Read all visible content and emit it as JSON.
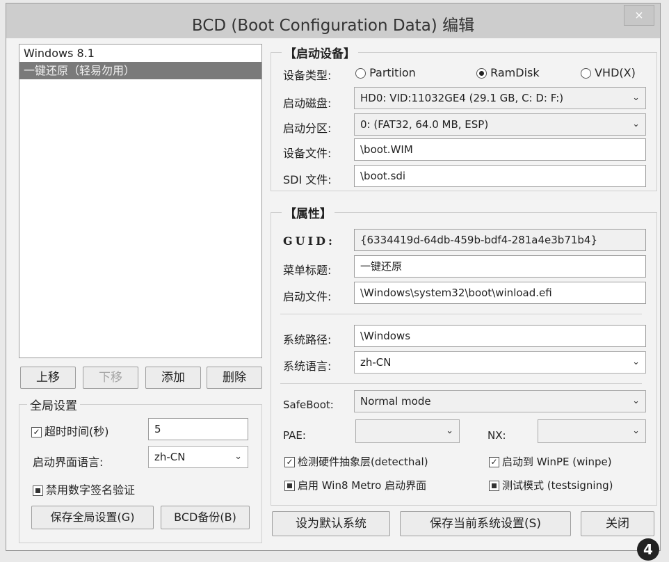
{
  "window": {
    "title": "BCD (Boot Configuration Data) 编辑",
    "close_glyph": "×"
  },
  "entries": [
    {
      "label": "Windows 8.1",
      "selected": false
    },
    {
      "label": "一键还原（轻易勿用）",
      "selected": true
    }
  ],
  "list_buttons": {
    "up": "上移",
    "down": "下移",
    "add": "添加",
    "delete": "删除"
  },
  "global": {
    "title": "全局设置",
    "timeout_label": "超时时间(秒)",
    "timeout_value": "5",
    "timeout_checked": true,
    "lang_label": "启动界面语言:",
    "lang_value": "zh-CN",
    "nosig_label": "禁用数字签名验证",
    "save_btn": "保存全局设置(G)",
    "backup_btn": "BCD备份(B)"
  },
  "boot_device": {
    "title": "【启动设备】",
    "type_label": "设备类型:",
    "type_options": [
      "Partition",
      "RamDisk",
      "VHD(X)"
    ],
    "type_selected": "RamDisk",
    "disk_label": "启动磁盘:",
    "disk_value": "HD0: VID:11032GE4 (29.1 GB, C: D: F:)",
    "partition_label": "启动分区:",
    "partition_value": "0: (FAT32,  64.0 MB, ESP)",
    "file_label": "设备文件:",
    "file_value": "\\boot.WIM",
    "sdi_label": "SDI 文件:",
    "sdi_value": "\\boot.sdi"
  },
  "properties": {
    "title": "【属性】",
    "guid_label": "GUID:",
    "guid_value": "{6334419d-64db-459b-bdf4-281a4e3b71b4}",
    "menu_label": "菜单标题:",
    "menu_value": "一键还原",
    "bootfile_label": "启动文件:",
    "bootfile_value": "\\Windows\\system32\\boot\\winload.efi",
    "syspath_label": "系统路径:",
    "syspath_value": "\\Windows",
    "syslang_label": "系统语言:",
    "syslang_value": "zh-CN",
    "safeboot_label": "SafeBoot:",
    "safeboot_value": "Normal mode",
    "pae_label": "PAE:",
    "pae_value": "",
    "nx_label": "NX:",
    "nx_value": "",
    "detecthal_label": "检测硬件抽象层(detecthal)",
    "winpe_label": "启动到 WinPE (winpe)",
    "metro_label": "启用 Win8 Metro 启动界面",
    "testsigning_label": "测试模式 (testsigning)"
  },
  "footer": {
    "default_btn": "设为默认系统",
    "save_btn": "保存当前系统设置(S)",
    "close_btn": "关闭"
  },
  "figure_badge": "4"
}
